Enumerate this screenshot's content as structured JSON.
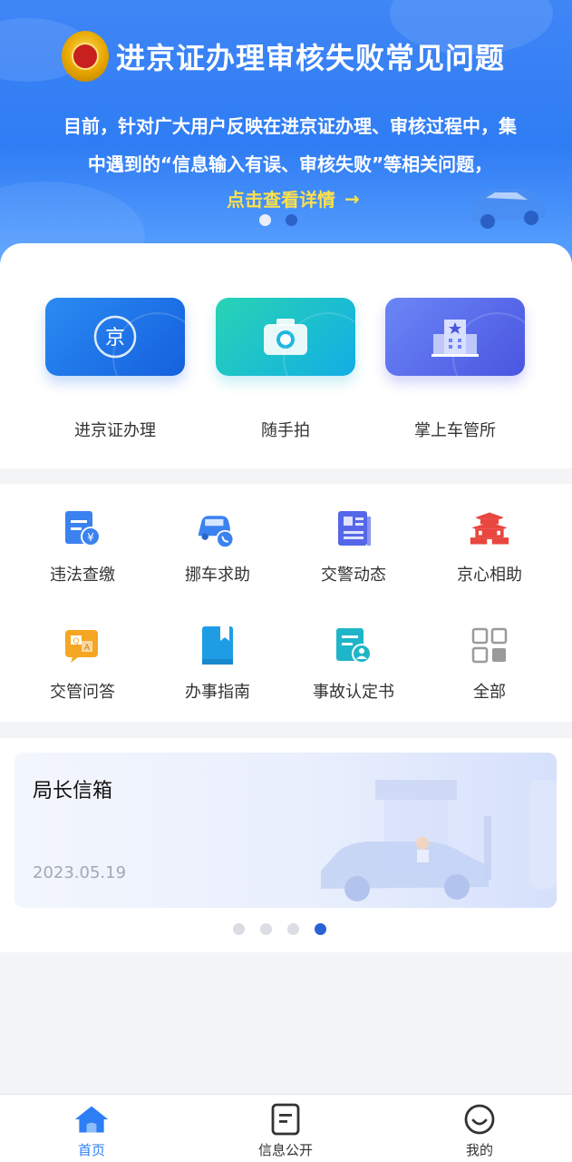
{
  "banner": {
    "title": "进京证办理审核失败常见问题",
    "line1": "目前，针对广大用户反映在进京证办理、审核过程中，集",
    "line2": "中遇到的“信息输入有误、审核失败”等相关问题，",
    "link_text": "点击查看详情",
    "link_arrow": "→",
    "active_slide": 1,
    "slide_count": 2
  },
  "features": [
    {
      "label": "进京证办理",
      "icon": "jing-badge-icon"
    },
    {
      "label": "随手拍",
      "icon": "camera-icon"
    },
    {
      "label": "掌上车管所",
      "icon": "building-icon"
    }
  ],
  "services": [
    {
      "label": "违法查缴",
      "icon": "fine-payment-icon"
    },
    {
      "label": "挪车求助",
      "icon": "move-car-icon"
    },
    {
      "label": "交警动态",
      "icon": "news-icon"
    },
    {
      "label": "京心相助",
      "icon": "tiananmen-icon"
    },
    {
      "label": "交管问答",
      "icon": "qa-icon"
    },
    {
      "label": "办事指南",
      "icon": "guide-book-icon"
    },
    {
      "label": "事故认定书",
      "icon": "accident-report-icon"
    },
    {
      "label": "全部",
      "icon": "grid-all-icon"
    }
  ],
  "mailbox": {
    "title": "局长信箱",
    "date": "2023.05.19",
    "active_slide": 4,
    "slide_count": 4
  },
  "tabs": [
    {
      "label": "首页",
      "icon": "home-icon",
      "active": true
    },
    {
      "label": "信息公开",
      "icon": "document-icon",
      "active": false
    },
    {
      "label": "我的",
      "icon": "smiley-icon",
      "active": false
    }
  ],
  "colors": {
    "primary": "#2d7ef4",
    "banner_link": "#ffe14a"
  }
}
